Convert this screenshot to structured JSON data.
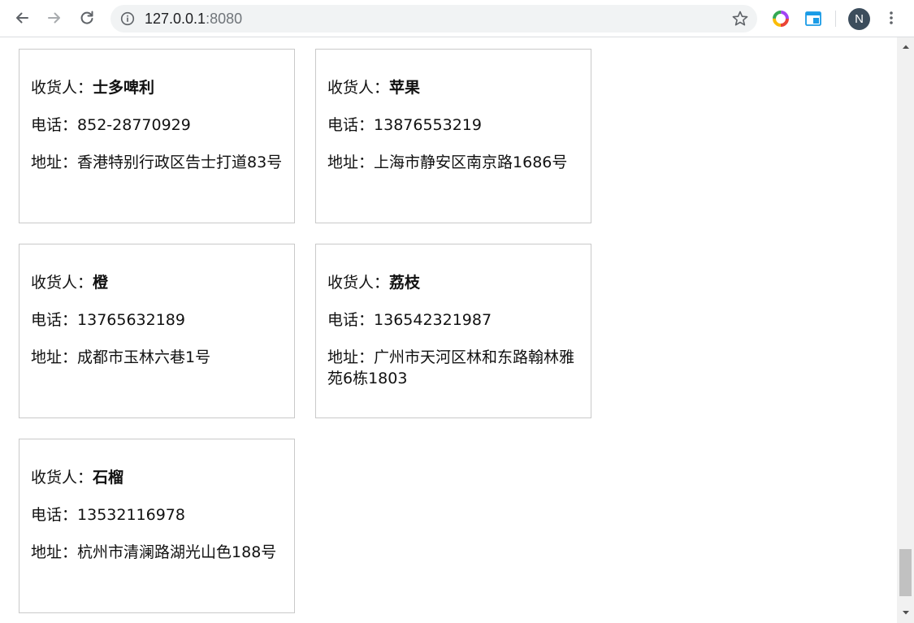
{
  "browser": {
    "url_host": "127.0.0.1",
    "url_port": ":8080",
    "avatar_letter": "N",
    "icons": {
      "back": "arrow-left-icon",
      "forward": "arrow-right-icon",
      "reload": "reload-icon",
      "site_info": "info-icon",
      "bookmark": "star-icon",
      "extension_1": "colorful-ring-extension-icon",
      "extension_2": "window-extension-icon",
      "menu": "vertical-dots-icon"
    }
  },
  "labels": {
    "recipient": "收货人：",
    "phone": "电话：",
    "address": "地址："
  },
  "addresses": [
    {
      "name": "士多啤利",
      "phone": "852-28770929",
      "address": "香港特别行政区告士打道83号"
    },
    {
      "name": "苹果",
      "phone": "13876553219",
      "address": "上海市静安区南京路1686号"
    },
    {
      "name": "橙",
      "phone": "13765632189",
      "address": "成都市玉林六巷1号"
    },
    {
      "name": "荔枝",
      "phone": "136542321987",
      "address": "广州市天河区林和东路翰林雅苑6栋1803"
    },
    {
      "name": "石榴",
      "phone": "13532116978",
      "address": "杭州市清澜路湖光山色188号"
    }
  ],
  "colors": {
    "card_border": "#c9c9c9",
    "omnibox_bg": "#f1f3f4",
    "avatar_bg": "#3c4d5c",
    "scroll_thumb": "#c1c1c1"
  }
}
